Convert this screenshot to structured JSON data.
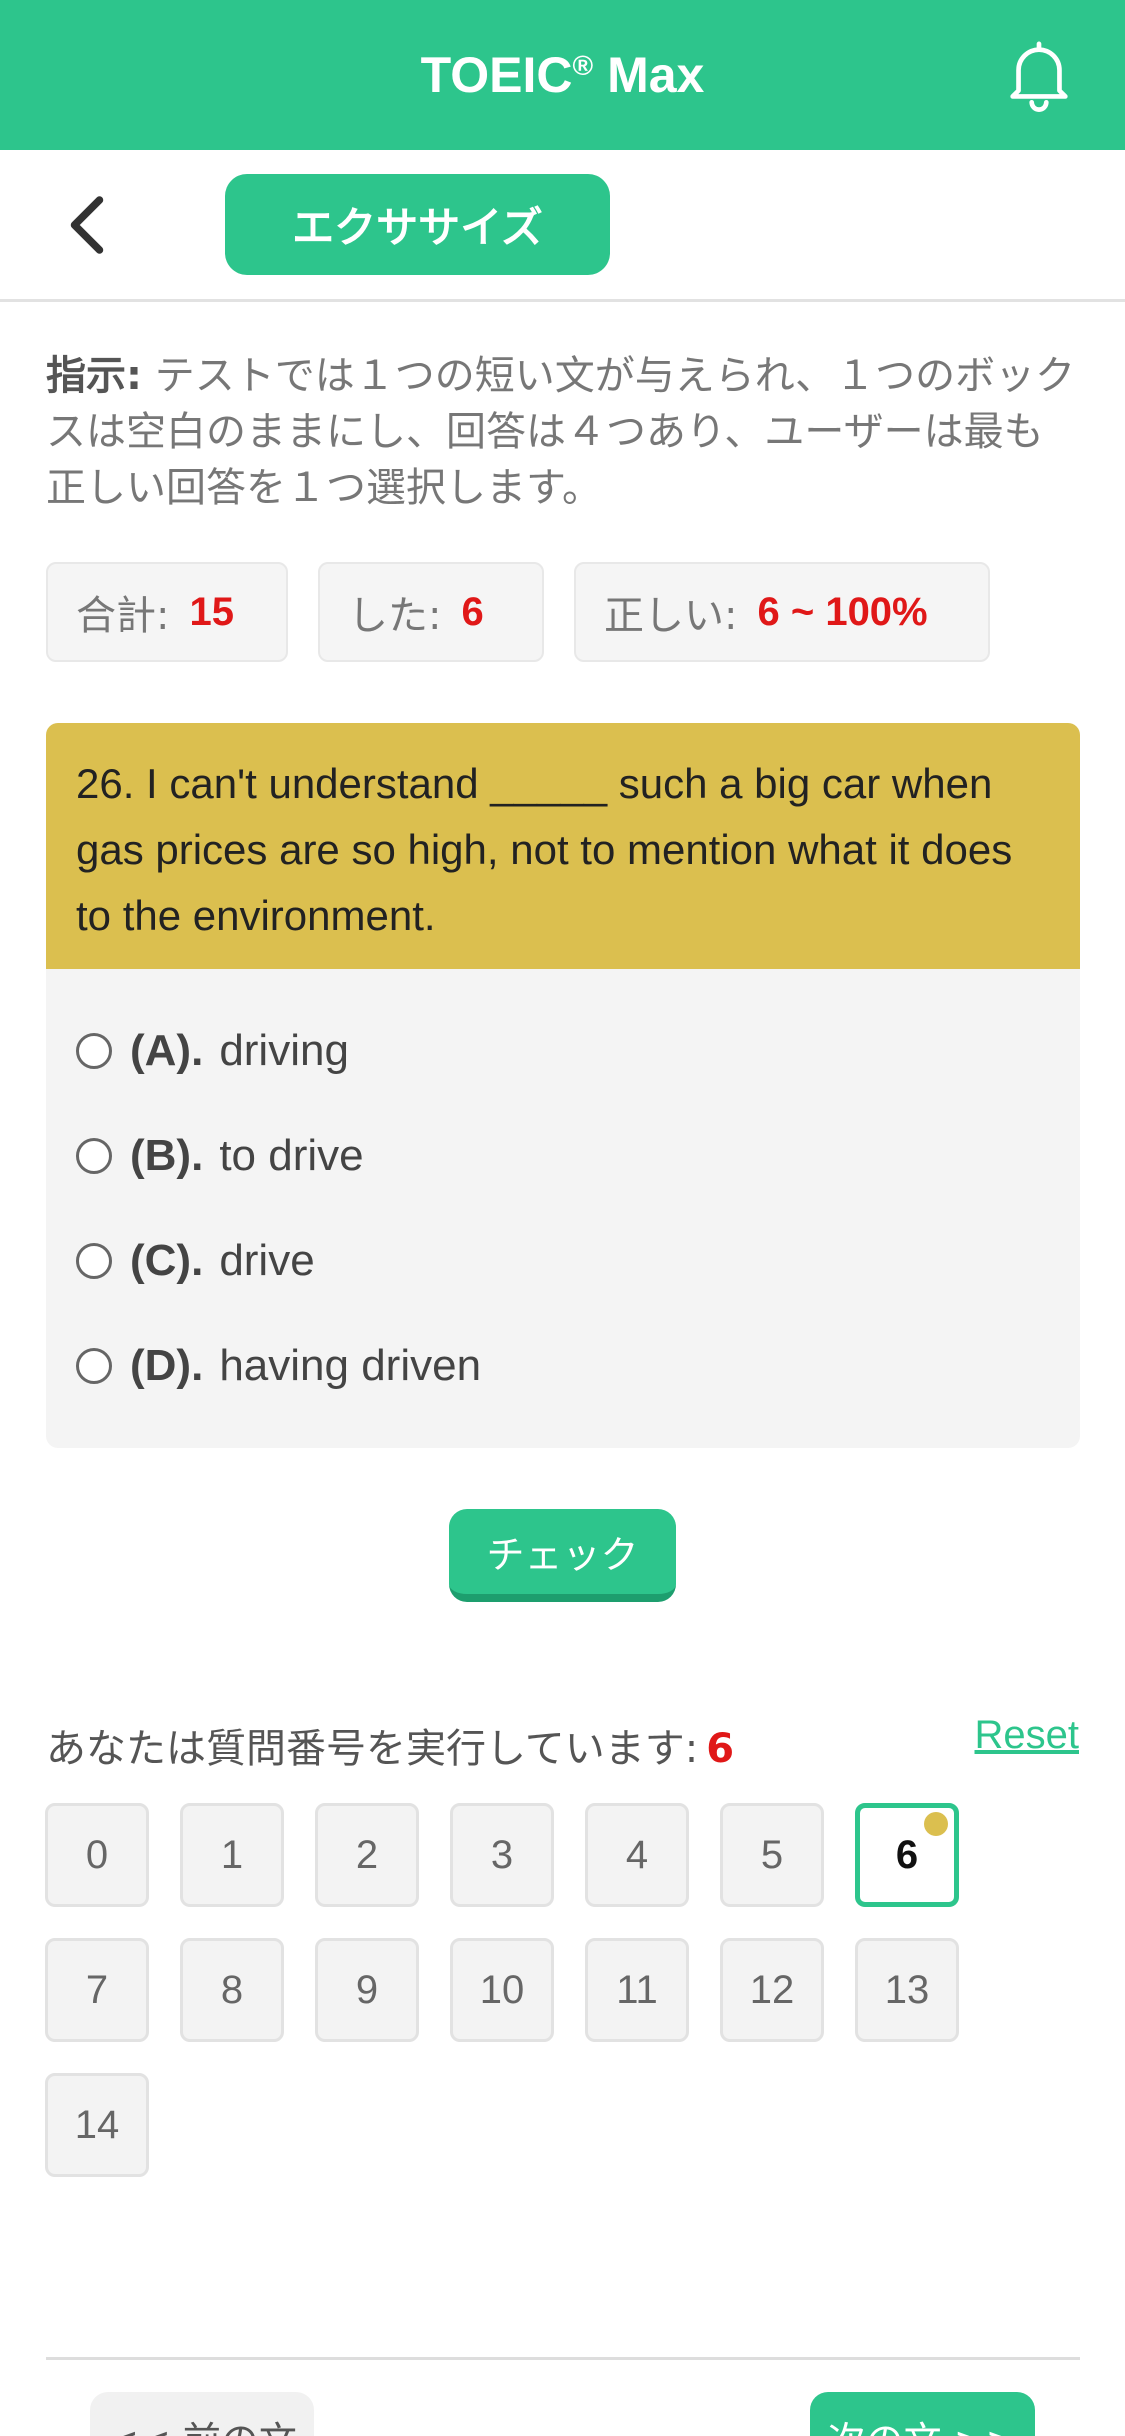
{
  "header": {
    "app_title": "TOEIC",
    "reg_mark": "®",
    "app_title_suffix": "Max"
  },
  "subnav": {
    "tab_label": "エクササイズ"
  },
  "instructions": {
    "label": "指示:",
    "text": " テストでは１つの短い文が与えられ、１つのボックスは空白のままにし、回答は４つあり、ユーザーは最も正しい回答を１つ選択します。"
  },
  "stats": {
    "total_label": "合計:",
    "total_value": "15",
    "done_label": "した:",
    "done_value": "6",
    "correct_label": "正しい:",
    "correct_value": "6 ~ 100%"
  },
  "question": {
    "text": "26. I can't understand _____ such a big car when gas prices are so high, not to mention what it does to the environment.",
    "options": [
      {
        "letter": "(A).",
        "text": "driving"
      },
      {
        "letter": "(B).",
        "text": "to drive"
      },
      {
        "letter": "(C).",
        "text": "drive"
      },
      {
        "letter": "(D).",
        "text": "having driven"
      }
    ]
  },
  "check_label": "チェック",
  "progress": {
    "label": "あなたは質問番号を実行しています:",
    "current": "6",
    "reset_label": "Reset",
    "numbers": [
      "0",
      "1",
      "2",
      "3",
      "4",
      "5",
      "6",
      "7",
      "8",
      "9",
      "10",
      "11",
      "12",
      "13",
      "14"
    ]
  },
  "nav": {
    "prev_label": "<< 前の文",
    "next_label": "次の文 >>"
  },
  "colors": {
    "accent": "#2dc58c",
    "question_bg": "#dbbf4f",
    "highlight_red": "#e01818"
  }
}
